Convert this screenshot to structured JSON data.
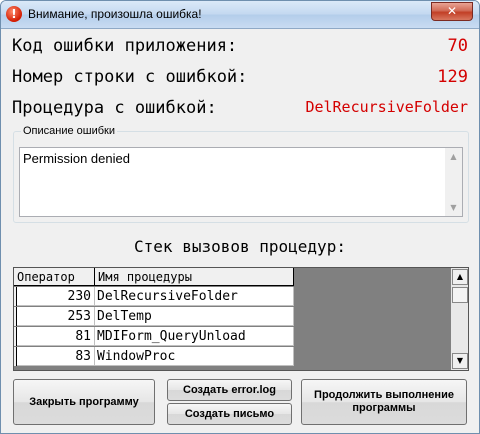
{
  "window": {
    "title": "Внимание, произошла ошибка!",
    "close_glyph": "✕",
    "title_icon_glyph": "!"
  },
  "info": {
    "error_code_label": "Код ошибки приложения:",
    "error_code_value": "70",
    "line_label": "Номер строки с ошибкой:",
    "line_value": "129",
    "procedure_label": "Процедура с ошибкой:",
    "procedure_value": "DelRecursiveFolder"
  },
  "description": {
    "legend": "Описание ошибки",
    "text": "Permission denied"
  },
  "stack": {
    "title": "Стек вызовов процедур:",
    "columns": [
      "Оператор",
      "Имя процедуры"
    ],
    "rows": [
      {
        "operator": "230",
        "name": "DelRecursiveFolder"
      },
      {
        "operator": "253",
        "name": "DelTemp"
      },
      {
        "operator": "81",
        "name": "MDIForm_QueryUnload"
      },
      {
        "operator": "83",
        "name": "WindowProc"
      }
    ]
  },
  "buttons": {
    "close_program": "Закрыть программу",
    "create_log": "Создать error.log",
    "create_letter": "Создать письмо",
    "continue": "Продолжить выполнение программы"
  },
  "colors": {
    "value_red": "#d40000",
    "grid_background": "#808080"
  }
}
